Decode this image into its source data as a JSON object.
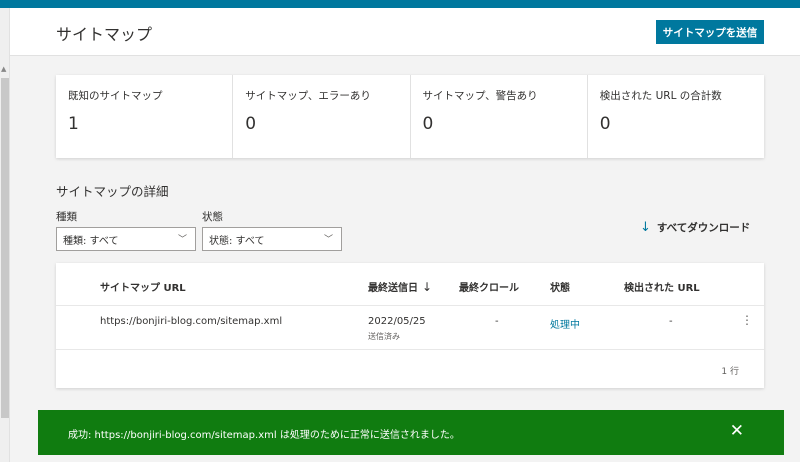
{
  "header": {
    "title": "サイトマップ",
    "submit_label": "サイトマップを送信"
  },
  "stats": [
    {
      "label": "既知のサイトマップ",
      "value": "1"
    },
    {
      "label": "サイトマップ、エラーあり",
      "value": "0"
    },
    {
      "label": "サイトマップ、警告あり",
      "value": "0"
    },
    {
      "label": "検出された URL の合計数",
      "value": "0"
    }
  ],
  "details": {
    "title": "サイトマップの詳細",
    "filters": {
      "type_label": "種類",
      "type_value": "種類: すべて",
      "status_label": "状態",
      "status_value": "状態: すべて"
    },
    "download_label": "すべてダウンロード"
  },
  "table": {
    "columns": [
      "サイトマップ URL",
      "最終送信日",
      "最終クロール",
      "状態",
      "検出された URL"
    ],
    "rows": [
      {
        "url": "https://bonjiri-blog.com/sitemap.xml",
        "submitted": "2022/05/25",
        "submitted_sub": "送信済み",
        "last_crawl": "-",
        "status": "処理中",
        "discovered": "-"
      }
    ],
    "row_count": "1 行"
  },
  "toast": {
    "message": "成功: https://bonjiri-blog.com/sitemap.xml は処理のために正常に送信されました。"
  },
  "colors": {
    "accent": "#00789e",
    "success": "#107c10"
  },
  "icons": {
    "download": "download-arrow-icon",
    "sort": "arrow-down-icon",
    "more": "more-vertical-icon",
    "close": "close-icon",
    "dropdown": "chevron-down-icon"
  }
}
